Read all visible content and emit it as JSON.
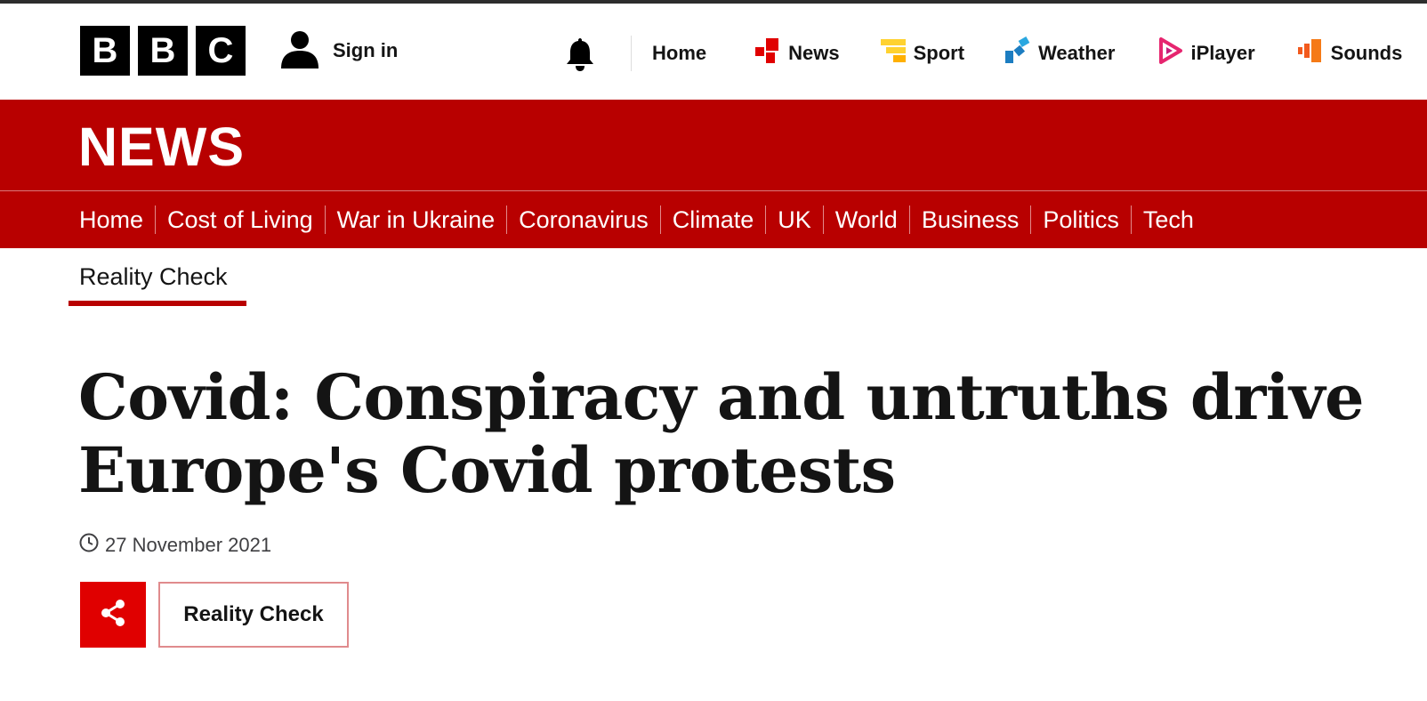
{
  "masthead": {
    "logo_letters": [
      "B",
      "B",
      "C"
    ],
    "sign_in_label": "Sign in",
    "global_nav": [
      {
        "label": "Home",
        "icon": "none",
        "color": "#141414"
      },
      {
        "label": "News",
        "icon": "news-icon",
        "color": "#e00000"
      },
      {
        "label": "Sport",
        "icon": "sport-icon",
        "color": "#ffd230"
      },
      {
        "label": "Weather",
        "icon": "weather-icon",
        "color": "#1c7dc1"
      },
      {
        "label": "iPlayer",
        "icon": "iplayer-icon",
        "color": "#e6256f"
      },
      {
        "label": "Sounds",
        "icon": "sounds-icon",
        "color": "#f25a1d"
      }
    ]
  },
  "banner": {
    "title": "NEWS",
    "background": "#b80000"
  },
  "section_nav": [
    "Home",
    "Cost of Living",
    "War in Ukraine",
    "Coronavirus",
    "Climate",
    "UK",
    "World",
    "Business",
    "Politics",
    "Tech"
  ],
  "subnav": {
    "active_label": "Reality Check"
  },
  "article": {
    "headline": "Covid: Conspiracy and untruths drive Europe's Covid protests",
    "date": "27 November 2021",
    "tag_label": "Reality Check"
  }
}
